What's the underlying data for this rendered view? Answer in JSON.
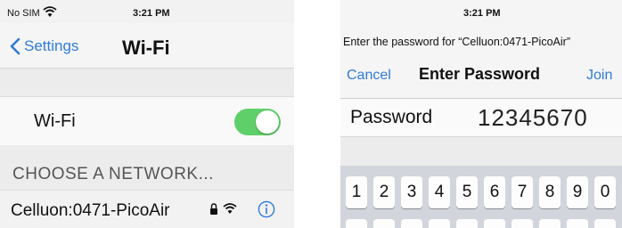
{
  "left_screen": {
    "status_bar": {
      "carrier": "No SIM",
      "time": "3:21 PM"
    },
    "nav": {
      "back_label": "Settings",
      "title": "Wi-Fi"
    },
    "wifi_toggle": {
      "label": "Wi-Fi",
      "on": true
    },
    "section_header": "CHOOSE A NETWORK...",
    "network": {
      "name": "Celluon:0471-PicoAir"
    }
  },
  "right_screen": {
    "status_bar": {
      "time": "3:21 PM"
    },
    "prompt": "Enter the password for “Celluon:0471-PicoAir”",
    "nav": {
      "cancel_label": "Cancel",
      "title": "Enter Password",
      "join_label": "Join"
    },
    "password": {
      "label": "Password",
      "value": "12345670"
    },
    "keyboard": {
      "keys": [
        "1",
        "2",
        "3",
        "4",
        "5",
        "6",
        "7",
        "8",
        "9",
        "0"
      ]
    }
  },
  "colors": {
    "accent": "#2f7bd9",
    "toggle_on": "#5fd069"
  }
}
